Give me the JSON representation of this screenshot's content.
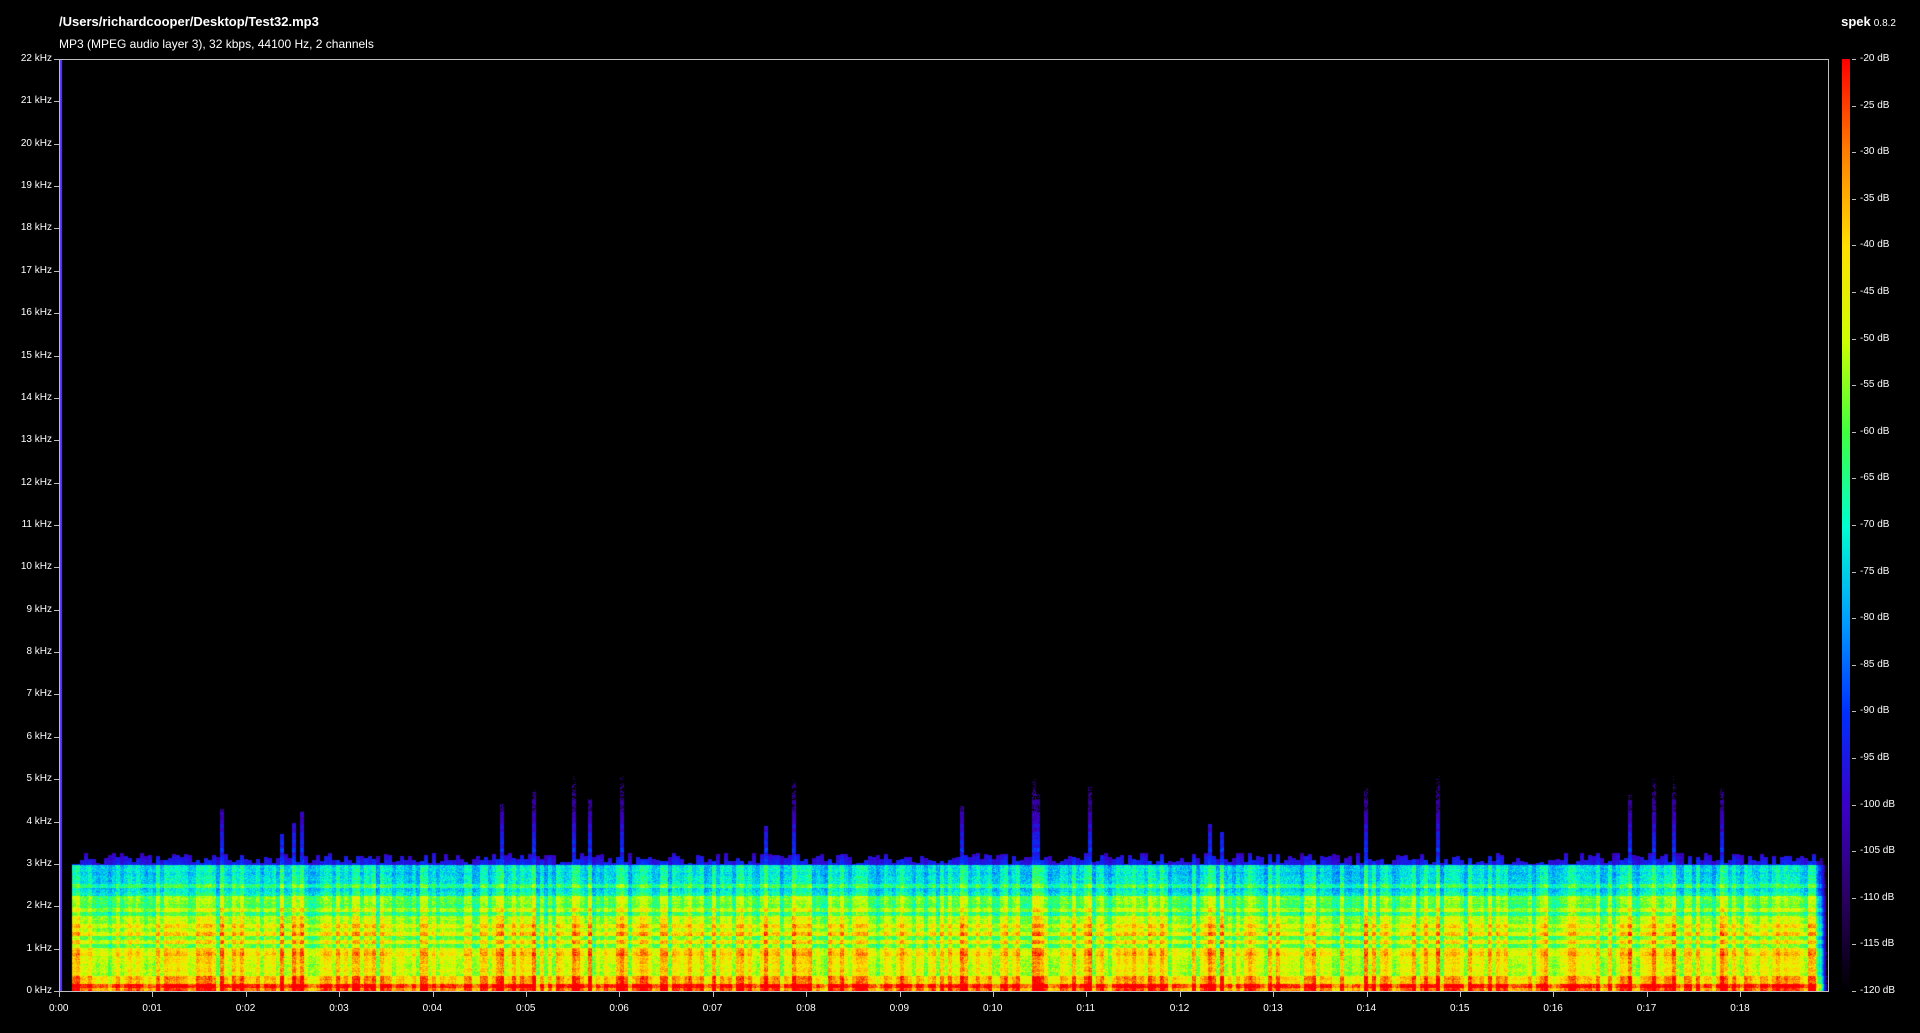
{
  "header": {
    "file_path": "/Users/richardcooper/Desktop/Test32.mp3",
    "file_info": "MP3 (MPEG audio layer 3), 32 kbps, 44100 Hz, 2 channels",
    "app_name": "spek",
    "app_version": "0.8.2"
  },
  "spectrogram": {
    "frequency_labels": [
      "22 kHz",
      "21 kHz",
      "20 kHz",
      "19 kHz",
      "18 kHz",
      "17 kHz",
      "16 kHz",
      "15 kHz",
      "14 kHz",
      "13 kHz",
      "12 kHz",
      "11 kHz",
      "10 kHz",
      "9 kHz",
      "8 kHz",
      "7 kHz",
      "6 kHz",
      "5 kHz",
      "4 kHz",
      "3 kHz",
      "2 kHz",
      "1 kHz",
      "0 kHz"
    ],
    "time_labels": [
      "0:00",
      "0:01",
      "0:02",
      "0:03",
      "0:04",
      "0:05",
      "0:06",
      "0:07",
      "0:08",
      "0:09",
      "0:10",
      "0:11",
      "0:12",
      "0:13",
      "0:14",
      "0:15",
      "0:16",
      "0:17",
      "0:18"
    ],
    "db_labels": [
      "-20 dB",
      "-25 dB",
      "-30 dB",
      "-35 dB",
      "-40 dB",
      "-45 dB",
      "-50 dB",
      "-55 dB",
      "-60 dB",
      "-65 dB",
      "-70 dB",
      "-75 dB",
      "-80 dB",
      "-85 dB",
      "-90 dB",
      "-95 dB",
      "-100 dB",
      "-105 dB",
      "-110 dB",
      "-115 dB",
      "-120 dB"
    ],
    "frequency_range_khz": [
      0,
      22
    ],
    "duration_seconds": 19,
    "db_range": [
      -120,
      -20
    ],
    "content_cutoff_khz": 3,
    "colormap": [
      "#000000",
      "#2a0060",
      "#3b00c8",
      "#0030ff",
      "#00a0ff",
      "#00ffd0",
      "#40ff40",
      "#d0ff00",
      "#ffe000",
      "#ff8000",
      "#ff0000"
    ]
  }
}
